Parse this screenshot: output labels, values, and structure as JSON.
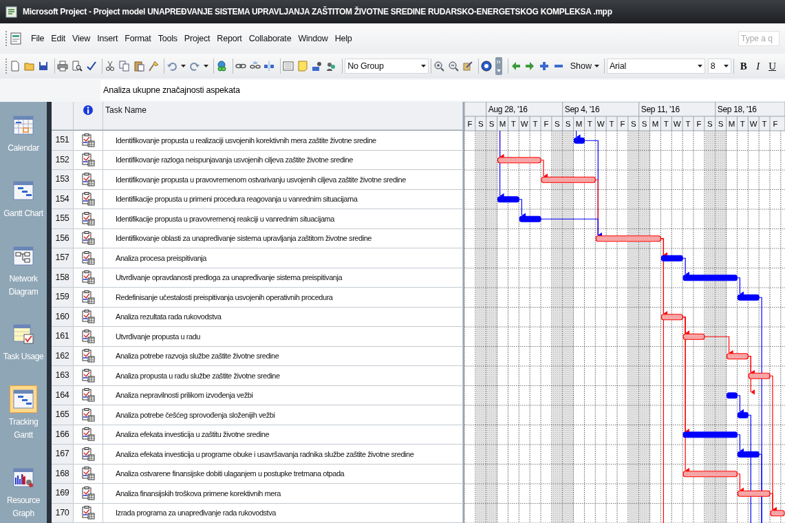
{
  "window": {
    "title": "Microsoft Project - Project model UNAPREĐVANJE SISTEMA UPRAVLJANJA ZAŠTITOM ŽIVOTNE SREDINE RUDARSKO-ENERGETSKOG KOMPLEKSA .mpp"
  },
  "menu": [
    "File",
    "Edit",
    "View",
    "Insert",
    "Format",
    "Tools",
    "Project",
    "Report",
    "Collaborate",
    "Window",
    "Help"
  ],
  "help_search": {
    "placeholder": "Type a q"
  },
  "toolbar": {
    "group": "No Group",
    "show": "Show",
    "font": "Arial",
    "font_size": "8",
    "bold": "B",
    "italic": "I",
    "underline": "U"
  },
  "entry_bar": {
    "value": "Analiza ukupne značajnosti aspekata"
  },
  "views": [
    {
      "label": "Calendar",
      "selected": false
    },
    {
      "label": "Gantt Chart",
      "selected": false
    },
    {
      "label": "Network Diagram",
      "selected": false
    },
    {
      "label": "Task Usage",
      "selected": false
    },
    {
      "label": "Tracking Gantt",
      "selected": true
    },
    {
      "label": "Resource Graph",
      "selected": false
    }
  ],
  "table": {
    "columns": [
      "Task Name"
    ],
    "rows": [
      {
        "id": "151",
        "name": "Identifikovanje propusta u realizaciji usvojenih korektivnih mera zaštite životne sredine"
      },
      {
        "id": "152",
        "name": "Identifikovanje razloga neispunjavanja usvojenih ciljeva zaštite životne sredine"
      },
      {
        "id": "153",
        "name": "Identifikovanje propusta u pravovremenom ostvarivanju usvojenih ciljeva zaštite životne sredine"
      },
      {
        "id": "154",
        "name": "Identifikacije propusta u primeni procedura reagovanja u vanrednim situacijama"
      },
      {
        "id": "155",
        "name": "Identifikacije propusta u pravovremenoj reakciji u vanrednim situacijama"
      },
      {
        "id": "156",
        "name": "Identifikovanje oblasti za unapređivanje sistema upravljanja zaštitom životne sredine"
      },
      {
        "id": "157",
        "name": "Analiza procesa preispitivanja"
      },
      {
        "id": "158",
        "name": "Utvrđivanje opravdanosti predloga za unapređivanje sistema preispitivanja"
      },
      {
        "id": "159",
        "name": "Redefinisanje učestalosti preispitivanja usvojenih operativnih procedura"
      },
      {
        "id": "160",
        "name": "Analiza rezultata rada rukovodstva"
      },
      {
        "id": "161",
        "name": "Utvrđivanje propusta u radu"
      },
      {
        "id": "162",
        "name": "Analiza potrebe razvoja službe zaštite životne sredine"
      },
      {
        "id": "163",
        "name": "Analiza propusta u radu službe zaštite životne sredine"
      },
      {
        "id": "164",
        "name": "Analiza nepravilnosti prilikom izvođenja vežbi"
      },
      {
        "id": "165",
        "name": "Analiza potrebe češćeg sprovođenja složenijih vežbi"
      },
      {
        "id": "166",
        "name": "Analiza efekata investicija u zaštitu životne sredine"
      },
      {
        "id": "167",
        "name": "Analiza efekata investicija u programe obuke i usavršavanja radnika službe zaštite životne sredine"
      },
      {
        "id": "168",
        "name": "Analiza ostvarene finansijske dobiti ulaganjem u postupke tretmana otpada"
      },
      {
        "id": "169",
        "name": "Analiza finansijskih troškova primene korektivnih mera"
      },
      {
        "id": "170",
        "name": "Izrada programa za unapređivanje rada rukovodstva"
      }
    ]
  },
  "timeline": {
    "days": [
      {
        "label": "F",
        "nonworking": false
      },
      {
        "label": "S",
        "nonworking": true
      },
      {
        "label": "S",
        "nonworking": true
      },
      {
        "label": "M",
        "nonworking": false
      },
      {
        "label": "T",
        "nonworking": false
      },
      {
        "label": "W",
        "nonworking": false
      },
      {
        "label": "T",
        "nonworking": false
      },
      {
        "label": "F",
        "nonworking": false
      },
      {
        "label": "S",
        "nonworking": true
      },
      {
        "label": "S",
        "nonworking": true
      },
      {
        "label": "M",
        "nonworking": false
      },
      {
        "label": "T",
        "nonworking": false
      },
      {
        "label": "W",
        "nonworking": false
      },
      {
        "label": "T",
        "nonworking": false
      },
      {
        "label": "F",
        "nonworking": false
      },
      {
        "label": "S",
        "nonworking": true
      },
      {
        "label": "S",
        "nonworking": true
      },
      {
        "label": "M",
        "nonworking": false
      },
      {
        "label": "T",
        "nonworking": false
      },
      {
        "label": "W",
        "nonworking": false
      },
      {
        "label": "T",
        "nonworking": false
      },
      {
        "label": "F",
        "nonworking": false
      },
      {
        "label": "S",
        "nonworking": true
      },
      {
        "label": "S",
        "nonworking": true
      },
      {
        "label": "M",
        "nonworking": false
      },
      {
        "label": "T",
        "nonworking": false
      },
      {
        "label": "W",
        "nonworking": false
      },
      {
        "label": "T",
        "nonworking": false
      },
      {
        "label": "F",
        "nonworking": false
      }
    ],
    "weeks": [
      "Aug 28, '16",
      "Sep 4, '16",
      "Sep 11, '16",
      "Sep 18, '16"
    ],
    "critical": [
      false,
      true,
      true,
      false,
      false,
      true,
      false,
      false,
      false,
      true,
      true,
      true,
      true,
      false,
      false,
      false,
      false,
      true,
      true,
      true
    ]
  }
}
